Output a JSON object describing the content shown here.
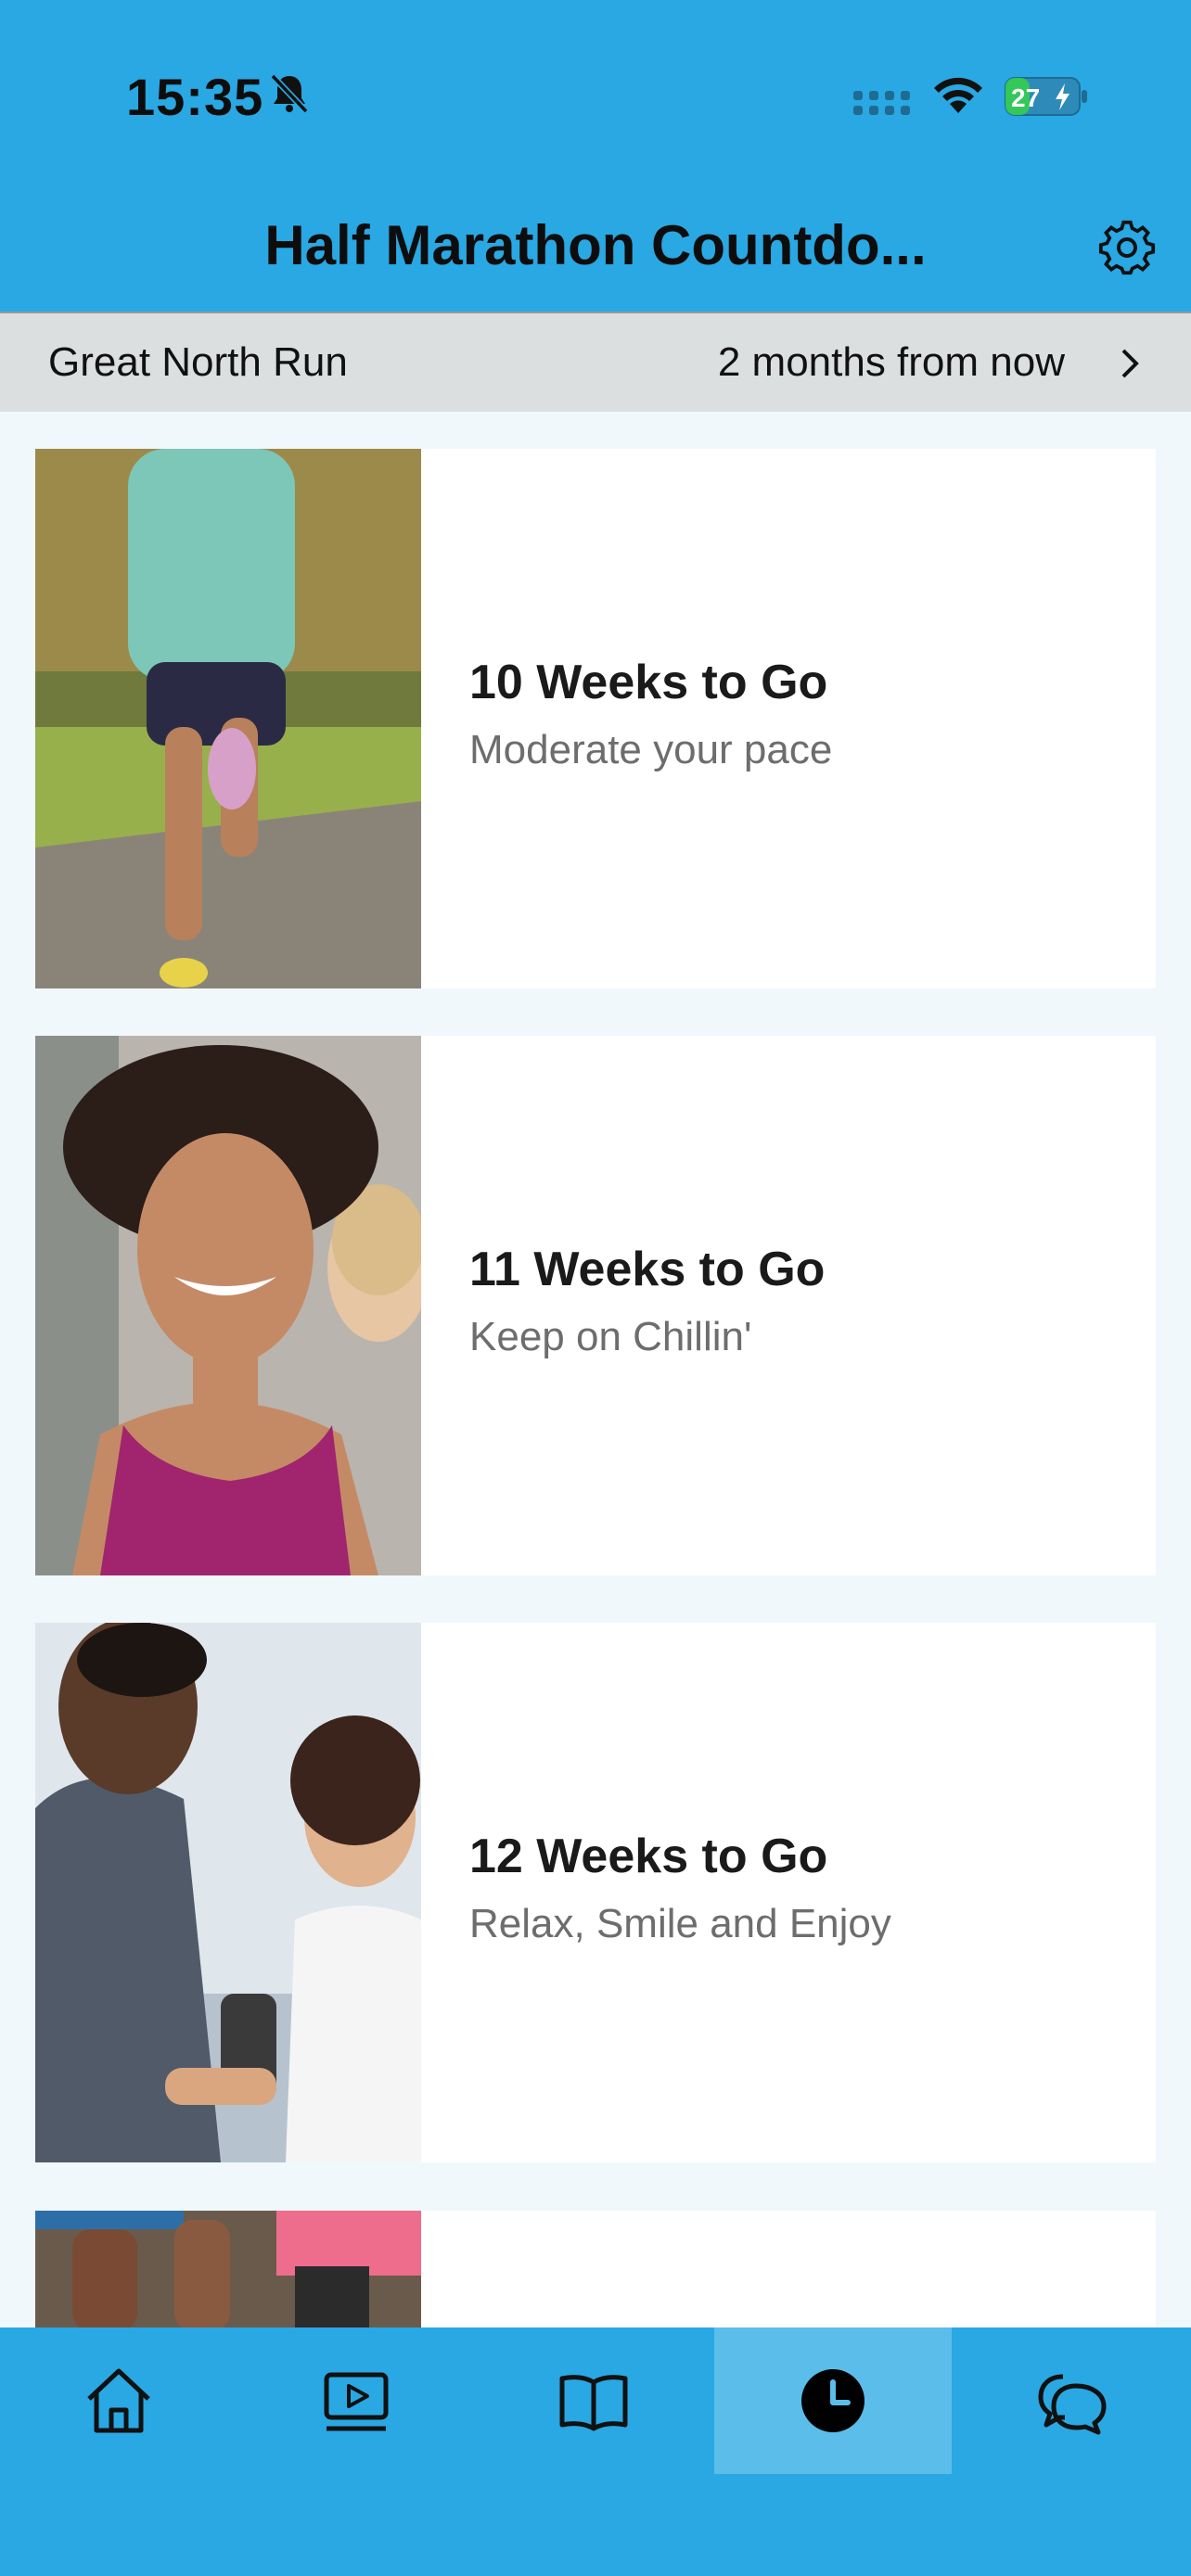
{
  "status_bar": {
    "time": "15:35",
    "battery_level": "27",
    "icons": [
      "bell-slash-icon",
      "cellular-signal-icon",
      "wifi-icon",
      "battery-charging-icon"
    ]
  },
  "header": {
    "title": "Half Marathon Countdo...",
    "settings_icon": "gear-icon"
  },
  "event": {
    "name": "Great North Run",
    "when": "2 months from now",
    "icon": "chevron-right-icon"
  },
  "cards": [
    {
      "title": "10 Weeks to Go",
      "subtitle": "Moderate your pace"
    },
    {
      "title": "11 Weeks to Go",
      "subtitle": "Keep on Chillin'"
    },
    {
      "title": "12 Weeks to Go",
      "subtitle": "Relax, Smile and Enjoy"
    }
  ],
  "tabs": [
    {
      "icon": "home-icon",
      "active": false
    },
    {
      "icon": "video-play-icon",
      "active": false
    },
    {
      "icon": "book-icon",
      "active": false
    },
    {
      "icon": "clock-icon",
      "active": true
    },
    {
      "icon": "chat-bubbles-icon",
      "active": false
    }
  ],
  "colors": {
    "brand_blue": "#29a8e3",
    "active_tab": "#5bbde9",
    "event_bar": "#dcdfe0",
    "page_background": "#f0f8fc"
  }
}
